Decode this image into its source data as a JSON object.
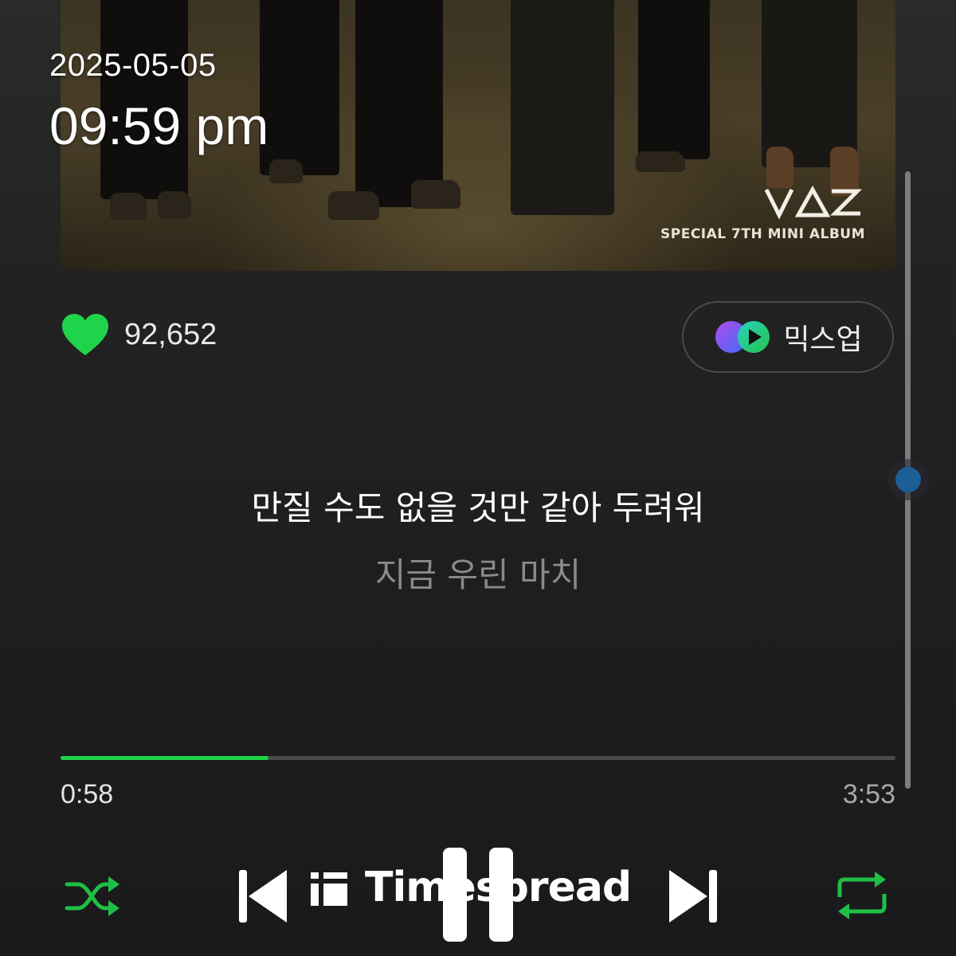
{
  "status": {
    "date": "2025-05-05",
    "time": "09:59 pm"
  },
  "album": {
    "logo_icon": "vaz-logo",
    "subtitle": "SPECIAL 7TH MINI ALBUM"
  },
  "like": {
    "icon": "heart-icon",
    "count": "92,652",
    "color": "#1fd44a"
  },
  "mixup": {
    "icon": "mixup-icon",
    "label": "믹스업"
  },
  "lyrics": {
    "current": "만질 수도 없을 것만 같아 두려워",
    "next": "지금 우린 마치"
  },
  "playback": {
    "elapsed": "0:58",
    "total": "3:53",
    "progress_fraction": 0.249,
    "accent": "#1fd44a"
  },
  "controls": {
    "shuffle_icon": "shuffle-icon",
    "previous_icon": "previous-icon",
    "pause_icon": "pause-icon",
    "next_icon": "next-icon",
    "repeat_icon": "repeat-icon"
  },
  "watermark": {
    "text": "Timespread"
  },
  "scroll": {
    "position_fraction": 0.49
  }
}
